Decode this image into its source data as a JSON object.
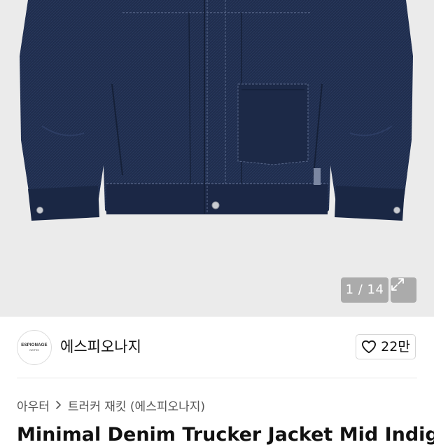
{
  "gallery": {
    "counter": "1 / 14",
    "colors": {
      "background": "#ebebeb",
      "denim": "#1f2d4d",
      "denim_dark": "#152038",
      "stitch": "#5b6a8c",
      "badge": "rgba(150,150,150,0.75)"
    }
  },
  "brand": {
    "logo_text_line1": "ESPIONAGE",
    "logo_text_line2": "NST'99",
    "name": "에스피오나지",
    "like_count": "22만"
  },
  "breadcrumb": {
    "items": [
      "아우터",
      "트러커 재킷 (에스피오나지)"
    ]
  },
  "product": {
    "title": "Minimal Denim Trucker Jacket Mid Indigo"
  }
}
